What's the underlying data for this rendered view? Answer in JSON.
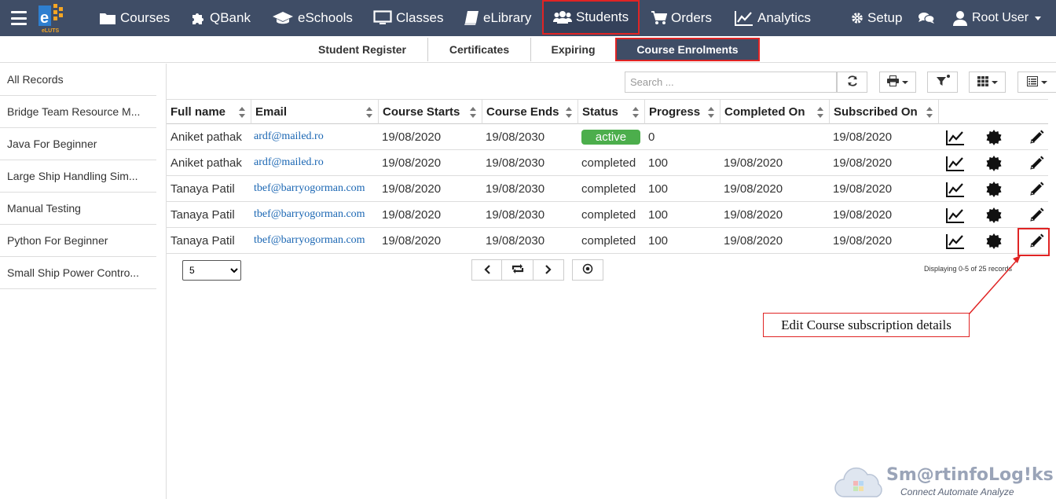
{
  "nav": {
    "items": [
      {
        "label": "Courses",
        "icon": "folder-icon"
      },
      {
        "label": "QBank",
        "icon": "puzzle-icon"
      },
      {
        "label": "eSchools",
        "icon": "graduation-cap-icon"
      },
      {
        "label": "Classes",
        "icon": "monitor-icon"
      },
      {
        "label": "eLibrary",
        "icon": "book-icon"
      },
      {
        "label": "Students",
        "icon": "users-icon",
        "active": true
      },
      {
        "label": "Orders",
        "icon": "cart-icon"
      },
      {
        "label": "Analytics",
        "icon": "line-chart-icon"
      }
    ],
    "setup_label": "Setup",
    "user_label": "Root User",
    "logo_text": "eLUTS"
  },
  "subnav": {
    "tabs": [
      {
        "label": "Student Register"
      },
      {
        "label": "Certificates"
      },
      {
        "label": "Expiring"
      },
      {
        "label": "Course Enrolments",
        "active": true
      }
    ]
  },
  "sidebar": {
    "items": [
      {
        "label": "All Records"
      },
      {
        "label": "Bridge Team Resource M..."
      },
      {
        "label": "Java For Beginner"
      },
      {
        "label": "Large Ship Handling Sim..."
      },
      {
        "label": "Manual Testing"
      },
      {
        "label": "Python For Beginner"
      },
      {
        "label": "Small Ship Power Contro..."
      }
    ]
  },
  "toolbar": {
    "search_placeholder": "Search ..."
  },
  "table": {
    "columns": [
      "Full name",
      "Email",
      "Course Starts",
      "Course Ends",
      "Status",
      "Progress",
      "Completed On",
      "Subscribed On"
    ],
    "rows": [
      {
        "name": "Aniket pathak",
        "email": "ardf@mailed.ro",
        "starts": "19/08/2020",
        "ends": "19/08/2030",
        "status": "active",
        "progress": "0",
        "completed": "",
        "subscribed": "19/08/2020"
      },
      {
        "name": "Aniket pathak",
        "email": "ardf@mailed.ro",
        "starts": "19/08/2020",
        "ends": "19/08/2030",
        "status": "completed",
        "progress": "100",
        "completed": "19/08/2020",
        "subscribed": "19/08/2020"
      },
      {
        "name": "Tanaya Patil",
        "email": "tbef@barryogorman.com",
        "starts": "19/08/2020",
        "ends": "19/08/2030",
        "status": "completed",
        "progress": "100",
        "completed": "19/08/2020",
        "subscribed": "19/08/2020"
      },
      {
        "name": "Tanaya Patil",
        "email": "tbef@barryogorman.com",
        "starts": "19/08/2020",
        "ends": "19/08/2030",
        "status": "completed",
        "progress": "100",
        "completed": "19/08/2020",
        "subscribed": "19/08/2020"
      },
      {
        "name": "Tanaya Patil",
        "email": "tbef@barryogorman.com",
        "starts": "19/08/2020",
        "ends": "19/08/2030",
        "status": "completed",
        "progress": "100",
        "completed": "19/08/2020",
        "subscribed": "19/08/2020"
      }
    ]
  },
  "pager": {
    "page_size": "5",
    "displaying": "Displaying 0-5 of 25 records"
  },
  "annotation": {
    "text": "Edit Course subscription details"
  },
  "watermark": {
    "title": "Sm@rtinfoLog!ks",
    "subtitle": "Connect Automate Analyze"
  },
  "colors": {
    "navbar": "#3f4d66",
    "active_badge": "#4cae4c",
    "highlight": "#e02424",
    "email_link": "#1a66b3"
  }
}
